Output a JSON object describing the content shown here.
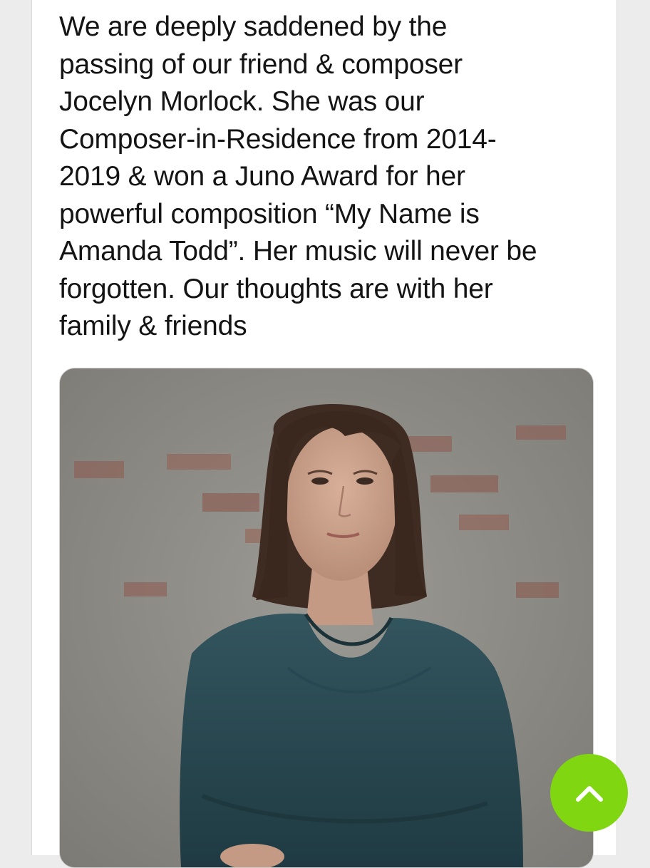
{
  "tweet": {
    "text_lines": [
      "We are deeply saddened by the",
      "passing of our friend & composer",
      "Jocelyn Morlock. She was our",
      "Composer-in-Residence from 2014-",
      "2019 & won a Juno Award for her",
      "powerful composition “My Name is",
      "Amanda Todd”. Her music will never be",
      "forgotten. Our thoughts are with her",
      "family & friends"
    ],
    "text_color": "#141414"
  },
  "media": {
    "type": "photo",
    "colors": {
      "wall": "#8d8b86",
      "brick": "#8e5a4e",
      "hair": "#3e2b22",
      "skin": "#caa08a",
      "top": "#2c4c55"
    }
  },
  "scroll_top_button": {
    "icon": "chevron-up-icon",
    "color": "#7fd611"
  }
}
